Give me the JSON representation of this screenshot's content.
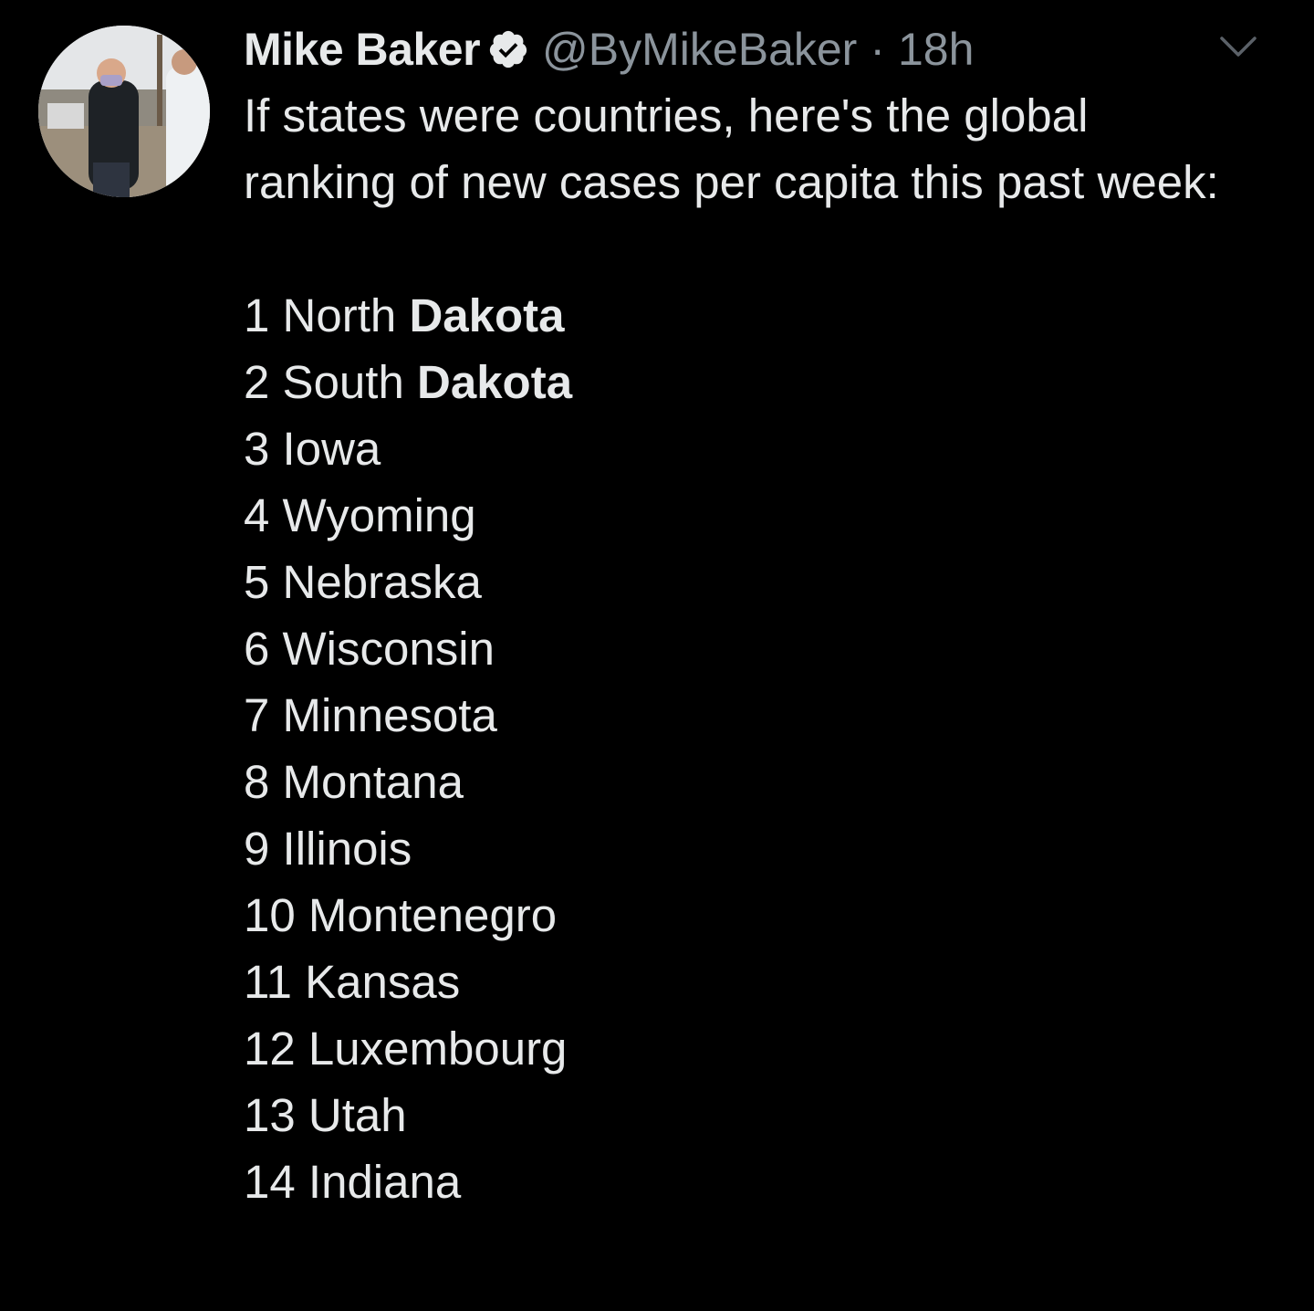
{
  "tweet": {
    "author_name": "Mike Baker",
    "handle": "@ByMikeBaker",
    "separator": "·",
    "time": "18h",
    "verified_icon": "verified-badge-icon",
    "menu_icon": "chevron-down-icon",
    "text": "If states were countries, here's the global ranking of new cases per capita this past week:",
    "ranking": [
      {
        "rank": "1",
        "name": "North",
        "bold": "Dakota"
      },
      {
        "rank": "2",
        "name": "South",
        "bold": "Dakota"
      },
      {
        "rank": "3",
        "name": "Iowa",
        "bold": ""
      },
      {
        "rank": "4",
        "name": "Wyoming",
        "bold": ""
      },
      {
        "rank": "5",
        "name": "Nebraska",
        "bold": ""
      },
      {
        "rank": "6",
        "name": "Wisconsin",
        "bold": ""
      },
      {
        "rank": "7",
        "name": "Minnesota",
        "bold": ""
      },
      {
        "rank": "8",
        "name": "Montana",
        "bold": ""
      },
      {
        "rank": "9",
        "name": "Illinois",
        "bold": ""
      },
      {
        "rank": "10",
        "name": "Montenegro",
        "bold": ""
      },
      {
        "rank": "11",
        "name": "Kansas",
        "bold": ""
      },
      {
        "rank": "12",
        "name": "Luxembourg",
        "bold": ""
      },
      {
        "rank": "13",
        "name": "Utah",
        "bold": ""
      },
      {
        "rank": "14",
        "name": "Indiana",
        "bold": ""
      }
    ]
  },
  "colors": {
    "background": "#000000",
    "text": "#e7e9ea",
    "muted": "#8b949c"
  }
}
